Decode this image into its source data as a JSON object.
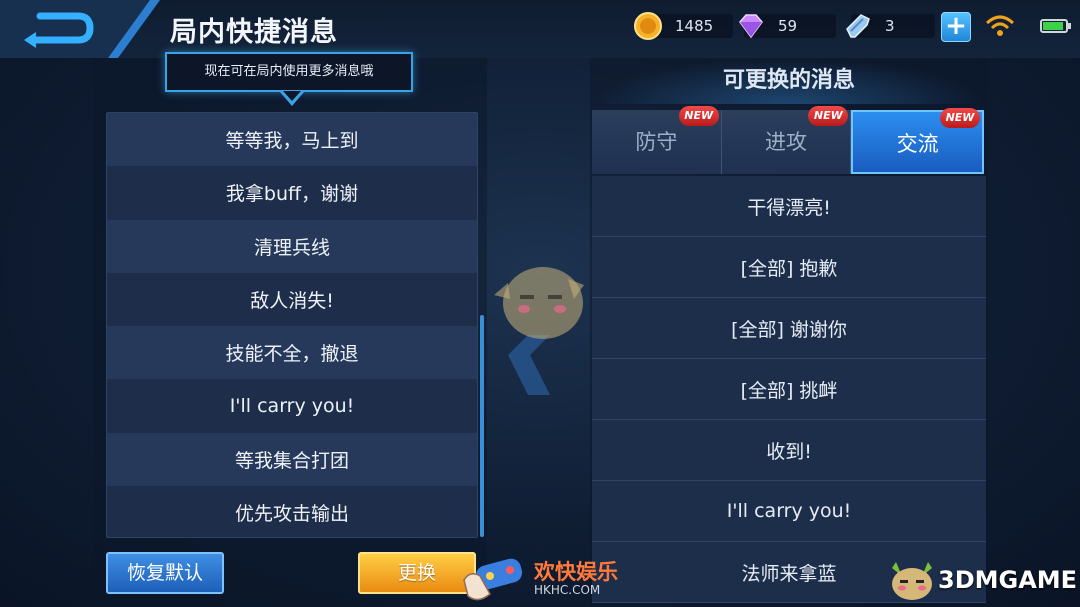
{
  "header": {
    "title": "局内快捷消息",
    "back_icon": "back-arrow-icon"
  },
  "resources": {
    "gold": "1485",
    "diamond": "59",
    "coupon": "3"
  },
  "tooltip": "现在可在局内使用更多消息哦",
  "current_messages": [
    "等等我，马上到",
    "我拿buff，谢谢",
    "清理兵线",
    "敌人消失!",
    "技能不全，撤退",
    "I'll carry you!",
    "等我集合打团",
    "优先攻击输出"
  ],
  "buttons": {
    "reset": "恢复默认",
    "replace": "更换"
  },
  "replaceable": {
    "title": "可更换的消息",
    "tabs": [
      {
        "label": "防守",
        "badge": "NEW"
      },
      {
        "label": "进攻",
        "badge": "NEW"
      },
      {
        "label": "交流",
        "badge": "NEW"
      }
    ],
    "active_tab": "交流",
    "options": [
      "干得漂亮!",
      "[全部] 抱歉",
      "[全部] 谢谢你",
      "[全部] 挑衅",
      "收到!",
      "I'll carry you!",
      "法师来拿蓝"
    ]
  },
  "watermarks": {
    "site_cn": "欢快娱乐",
    "site_url": "HKHC.COM",
    "brand": "3DMGAME"
  },
  "colors": {
    "accent_blue": "#2b8ff0",
    "orange_button": "#e98b12",
    "new_badge": "#e53535"
  }
}
